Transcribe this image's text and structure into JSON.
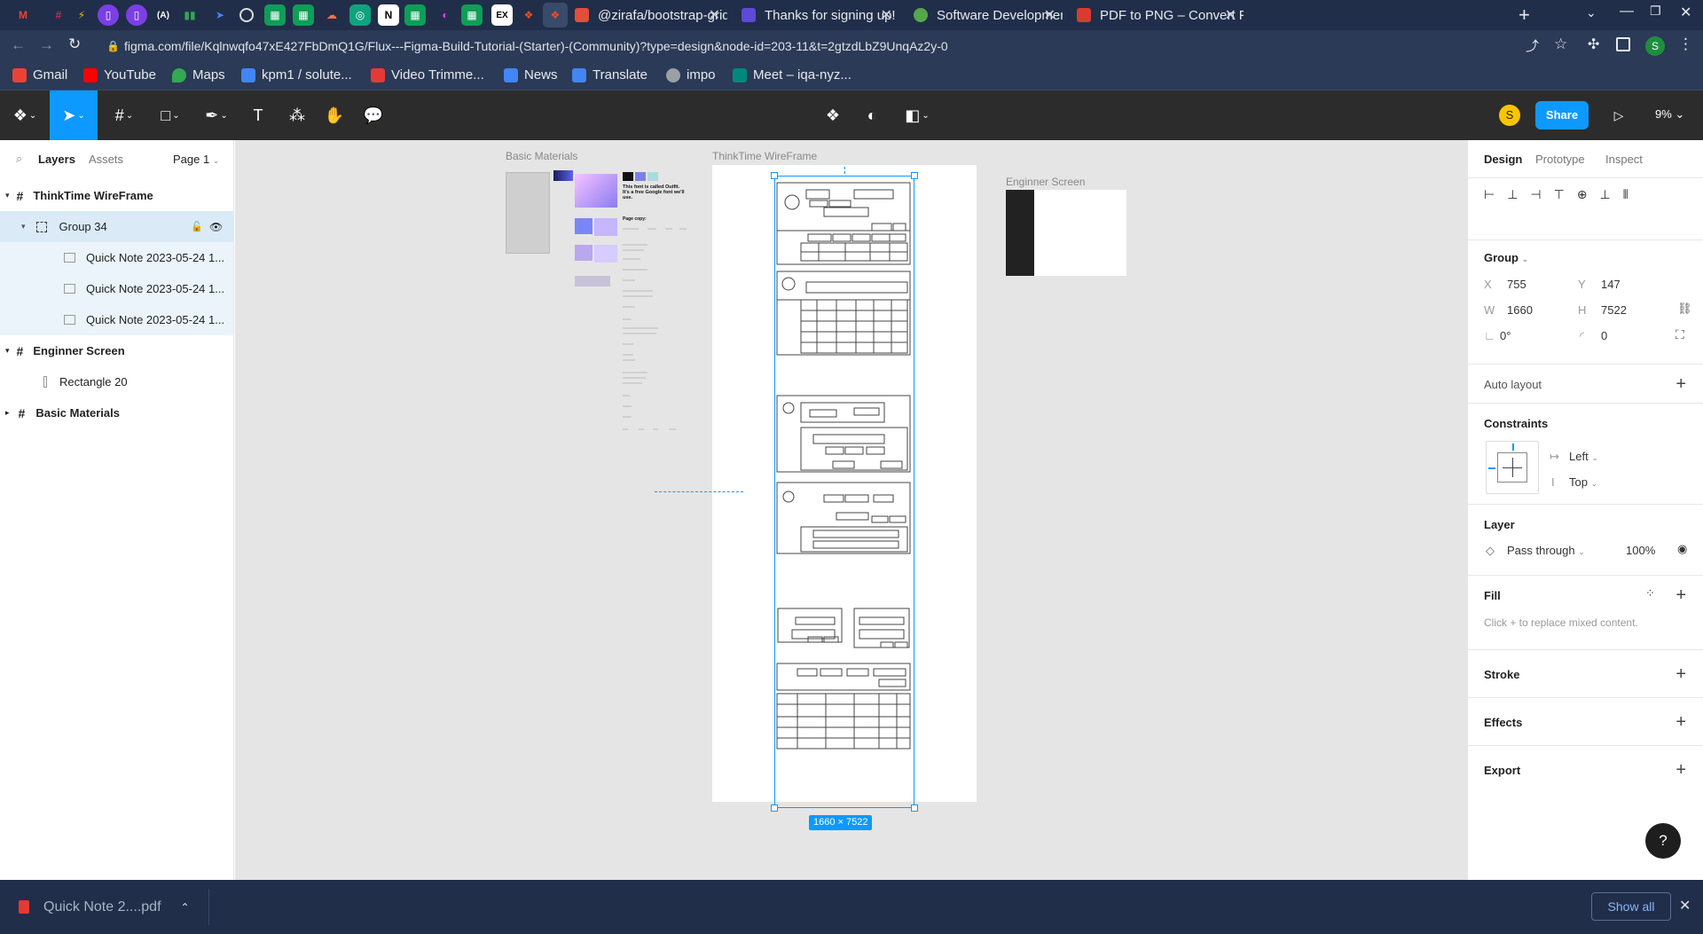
{
  "browser": {
    "tabs": [
      {
        "title": "@zirafa/bootstrap-grid",
        "icon": "gitpod-icon",
        "color": "#e24d3c"
      },
      {
        "title": "Thanks for signing up!",
        "icon": "form-icon",
        "color": "#5b4bd6"
      },
      {
        "title": "Software Development",
        "icon": "leaf-icon",
        "color": "#56a74b"
      },
      {
        "title": "PDF to PNG – Convert P",
        "icon": "pdf-icon",
        "color": "#d83b2f"
      }
    ],
    "url": "figma.com/file/Kqlnwqfo47xE427FbDmQ1G/Flux---Figma-Build-Tutorial-(Starter)-(Community)?type=design&node-id=203-11&t=2gtzdLbZ9UnqAz2y-0",
    "bookmarks": [
      "Gmail",
      "YouTube",
      "Maps",
      "kpm1 / solute...",
      "Video Trimme...",
      "News",
      "Translate",
      "impo",
      "Meet – iqa-nyz..."
    ],
    "profile_initial": "S"
  },
  "figma": {
    "share_label": "Share",
    "zoom": "9%",
    "user_initial": "S"
  },
  "left_panel": {
    "tabs": [
      "Layers",
      "Assets"
    ],
    "page": "Page 1",
    "layers": [
      {
        "name": "ThinkTime WireFrame"
      },
      {
        "name": "Group 34"
      },
      {
        "name": "Quick Note 2023-05-24 1..."
      },
      {
        "name": "Quick Note 2023-05-24 1..."
      },
      {
        "name": "Quick Note 2023-05-24 1..."
      },
      {
        "name": "Enginner Screen"
      },
      {
        "name": "Rectangle 20"
      },
      {
        "name": "Basic Materials"
      }
    ]
  },
  "canvas": {
    "frame_labels": [
      "Basic Materials",
      "ThinkTime WireFrame",
      "Enginner Screen"
    ],
    "size_badge": "1660 × 7522",
    "materials_heading": "This font is called Outfit. It's a free Google font we'll use.",
    "page_copy": "Page copy:"
  },
  "right_panel": {
    "tabs": [
      "Design",
      "Prototype",
      "Inspect"
    ],
    "group_label": "Group",
    "x": "755",
    "y": "147",
    "w": "1660",
    "h": "7522",
    "rotation": "0°",
    "radius": "0",
    "auto_layout": "Auto layout",
    "constraints": "Constraints",
    "constraint_h": "Left",
    "constraint_v": "Top",
    "layer": "Layer",
    "blend": "Pass through",
    "opacity": "100%",
    "fill": "Fill",
    "fill_hint": "Click + to replace mixed content.",
    "stroke": "Stroke",
    "effects": "Effects",
    "export": "Export",
    "help": "?"
  },
  "downloads": {
    "file": "Quick Note 2....pdf",
    "show_all": "Show all"
  }
}
